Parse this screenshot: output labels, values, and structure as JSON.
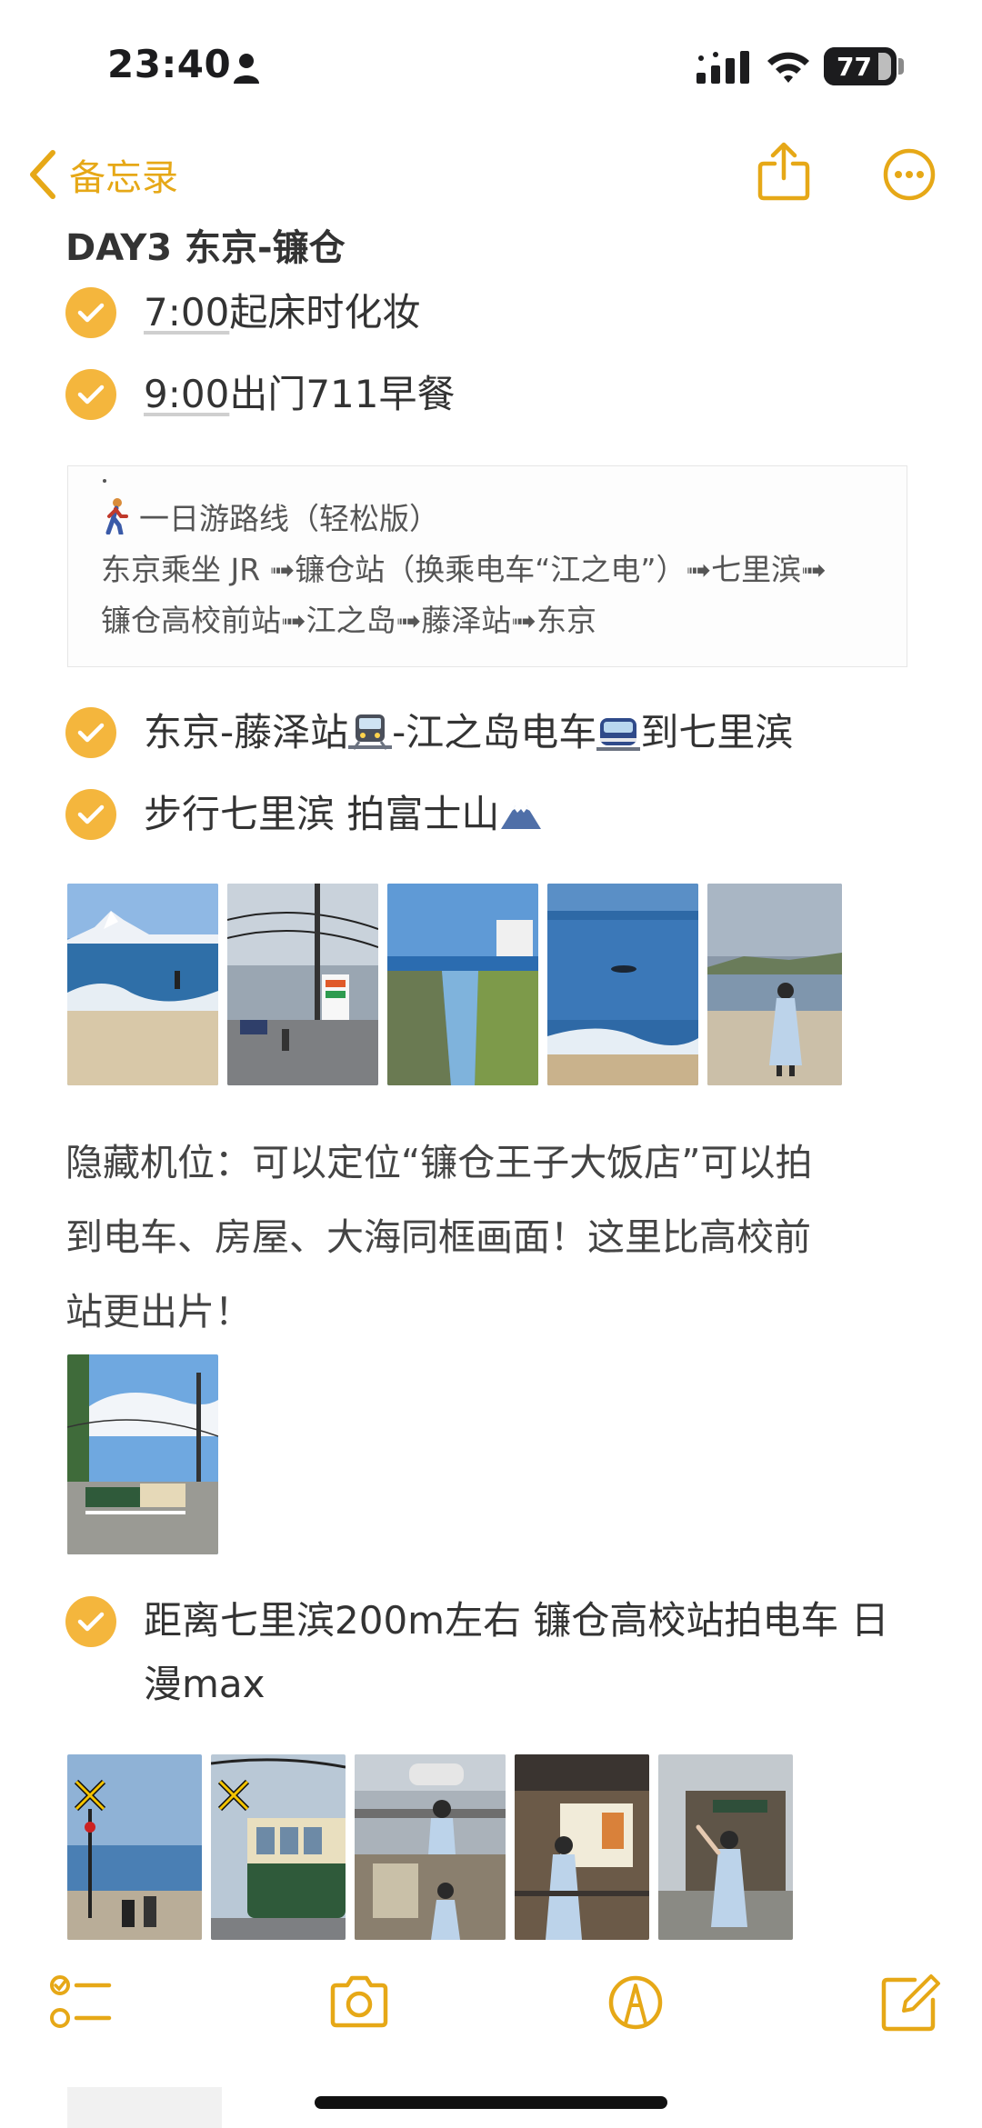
{
  "status_bar": {
    "time": "23:40",
    "battery": "77"
  },
  "nav": {
    "back_label": "备忘录"
  },
  "note": {
    "heading": "DAY3 东京-镰仓",
    "items": [
      {
        "time": "7:00",
        "text": "起床时化妆"
      },
      {
        "time": "9:00",
        "text": "出门711早餐"
      }
    ],
    "route": {
      "line1": "一日游路线（轻松版）",
      "line2": "东京乘坐 JR ➟镰仓站（换乘电车“江之电”）➟七里滨➟",
      "line3": "镰仓高校前站➟江之岛➟藤泽站➟东京"
    },
    "items2": [
      {
        "part1": "东京-藤泽站",
        "part2": "-江之岛电车",
        "part3": "到七里滨"
      },
      {
        "part1": "步行七里滨 拍富士山"
      }
    ],
    "paragraph": {
      "line1": "隐藏机位：可以定位“镰仓王子大饭店”可以拍",
      "line2": "到电车、房屋、大海同框画面！这里比高校前",
      "line3": "站更出片！"
    },
    "item3": {
      "line1": "距离七里滨200m左右 镰仓高校站拍电车 日",
      "line2": "漫max"
    }
  },
  "colors": {
    "accent": "#e6a817",
    "check": "#f4b63d",
    "text": "#333333"
  },
  "icons": {
    "back": "chevron-left-icon",
    "share": "share-icon",
    "more": "ellipsis-circle-icon",
    "checklist": "checklist-icon",
    "camera": "camera-icon",
    "markup": "markup-pen-icon",
    "compose": "compose-icon"
  }
}
